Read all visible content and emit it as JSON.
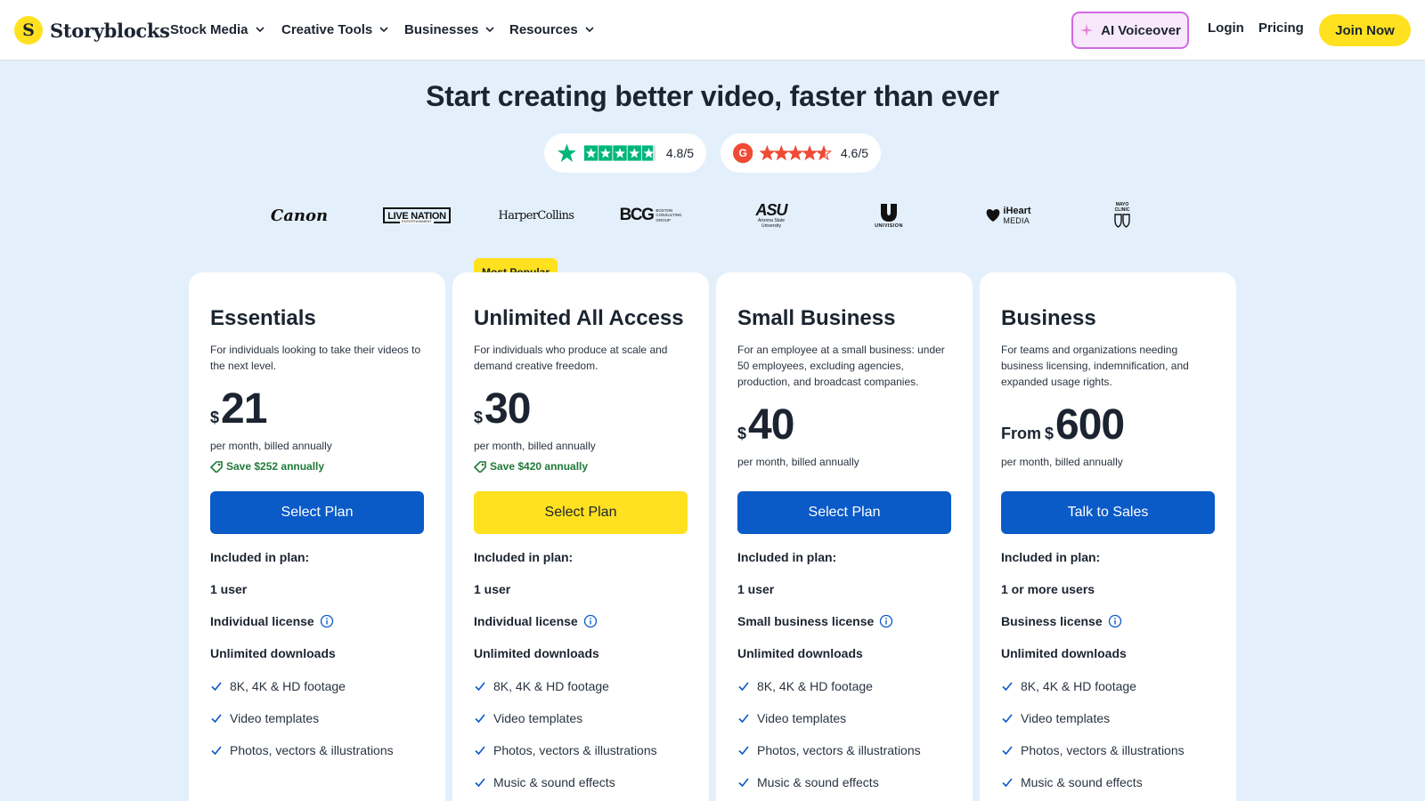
{
  "brand": {
    "name": "Storyblocks",
    "logo_glyph": "S"
  },
  "nav": {
    "items": [
      {
        "label": "Stock Media"
      },
      {
        "label": "Creative Tools"
      },
      {
        "label": "Businesses"
      },
      {
        "label": "Resources"
      }
    ],
    "ai_voiceover": "AI Voiceover",
    "login": "Login",
    "pricing": "Pricing",
    "join": "Join Now"
  },
  "hero": {
    "title": "Start creating better video, faster than ever",
    "ratings": [
      {
        "source": "trustpilot",
        "value": "4.8/5",
        "stars": 4.8
      },
      {
        "source": "g2",
        "value": "4.6/5",
        "stars": 4.6
      }
    ]
  },
  "logos": [
    {
      "name": "Canon",
      "text": "Canon"
    },
    {
      "name": "Live Nation",
      "text": "LIVE NATION",
      "sub": "ENTERTAINMENT"
    },
    {
      "name": "HarperCollins",
      "text": "HarperCollins"
    },
    {
      "name": "BCG",
      "text": "BCG",
      "sub": "BOSTON CONSULTING GROUP"
    },
    {
      "name": "ASU",
      "text": "ASU",
      "sub": "Arizona State University"
    },
    {
      "name": "Univision",
      "text": "UNIVISION"
    },
    {
      "name": "iHeartMedia",
      "text": "iHeart",
      "sub": "MEDIA"
    },
    {
      "name": "Mayo Clinic",
      "text": "MAYO CLINIC"
    }
  ],
  "most_popular": "Most Popular",
  "plans": [
    {
      "name": "Essentials",
      "desc": "For individuals looking to take their videos to the next level.",
      "from": "",
      "currency": "$",
      "price": "21",
      "billed": "per month, billed annually",
      "save": "Save $252 annually",
      "cta": "Select Plan",
      "included": "Included in plan:",
      "users": "1 user",
      "license": "Individual license",
      "downloads": "Unlimited downloads",
      "features": [
        "8K, 4K & HD footage",
        "Video templates",
        "Photos, vectors & illustrations"
      ]
    },
    {
      "name": "Unlimited All Access",
      "desc": "For individuals who produce at scale and demand creative freedom.",
      "from": "",
      "currency": "$",
      "price": "30",
      "billed": "per month, billed annually",
      "save": "Save $420 annually",
      "cta": "Select Plan",
      "included": "Included in plan:",
      "users": "1 user",
      "license": "Individual license",
      "downloads": "Unlimited downloads",
      "features": [
        "8K, 4K & HD footage",
        "Video templates",
        "Photos, vectors & illustrations",
        "Music & sound effects"
      ]
    },
    {
      "name": "Small Business",
      "desc": "For an employee at a small business: under 50 employees, excluding agencies, production, and broadcast companies.",
      "from": "",
      "currency": "$",
      "price": "40",
      "billed": "per month, billed annually",
      "save": "",
      "cta": "Select Plan",
      "included": "Included in plan:",
      "users": "1 user",
      "license": "Small business license",
      "downloads": "Unlimited downloads",
      "features": [
        "8K, 4K & HD footage",
        "Video templates",
        "Photos, vectors & illustrations",
        "Music & sound effects"
      ]
    },
    {
      "name": "Business",
      "desc": "For teams and organizations needing business licensing, indemnification, and expanded usage rights.",
      "from": "From",
      "currency": "$",
      "price": "600",
      "billed": "per month, billed annually",
      "save": "",
      "cta": "Talk to Sales",
      "included": "Included in plan:",
      "users": "1 or more users",
      "license": "Business license",
      "downloads": "Unlimited downloads",
      "features": [
        "8K, 4K & HD footage",
        "Video templates",
        "Photos, vectors & illustrations",
        "Music & sound effects"
      ]
    }
  ],
  "colors": {
    "page_bg": "#e3f0fc",
    "brand_yellow": "#ffe11f",
    "primary_blue": "#0a5ac8",
    "save_green": "#1f7a38",
    "trustpilot_green": "#00b67a",
    "g2_red": "#ef4a35"
  }
}
